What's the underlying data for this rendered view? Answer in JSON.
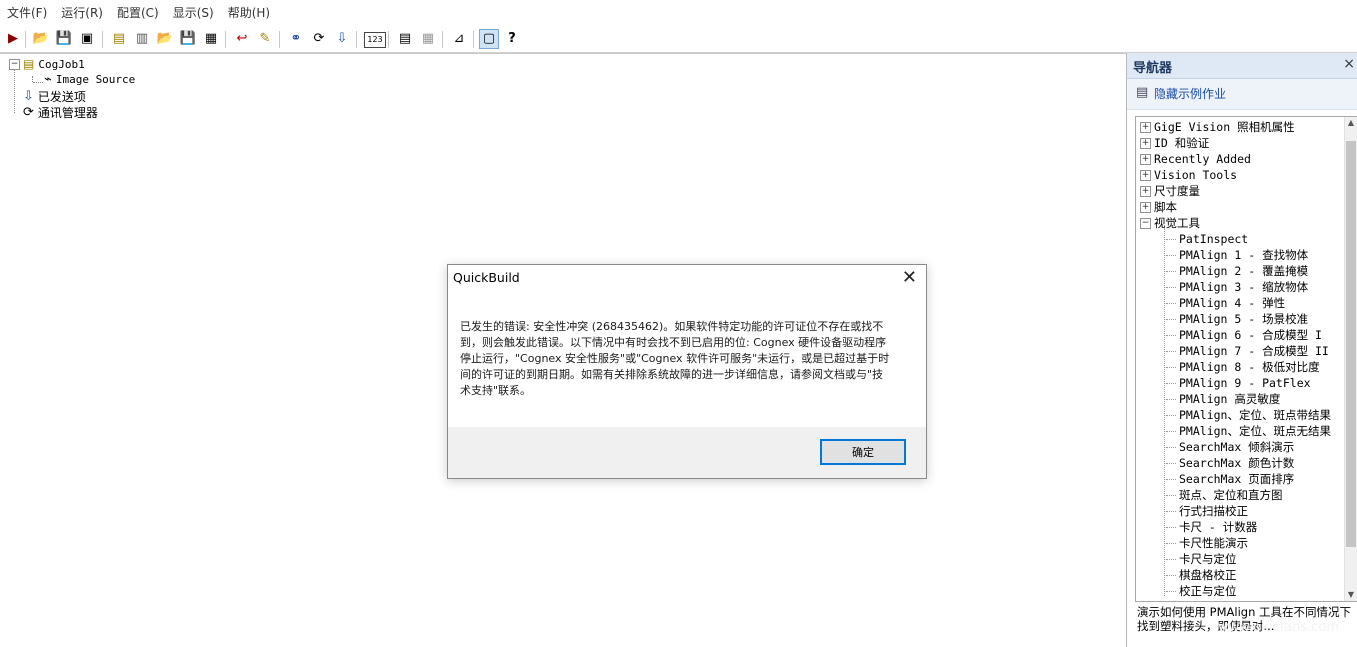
{
  "menubar": {
    "items": [
      "文件(F)",
      "运行(R)",
      "配置(C)",
      "显示(S)",
      "帮助(H)"
    ]
  },
  "toolbar": {
    "buttons": [
      {
        "icon": "run-icon",
        "glyph": "▶",
        "color": "#8b0000"
      },
      {
        "icon": "open-folder-icon",
        "glyph": "📂",
        "color": "#caa300"
      },
      {
        "icon": "save-icon",
        "glyph": "💾",
        "color": "#000"
      },
      {
        "icon": "save-all-icon",
        "glyph": "▣",
        "color": "#000"
      },
      {
        "icon": "job-properties-icon",
        "glyph": "▤",
        "color": "#a08000"
      },
      {
        "icon": "new-job-icon",
        "glyph": "▥",
        "color": "#555"
      },
      {
        "icon": "open-job-icon",
        "glyph": "📂",
        "color": "#caa300"
      },
      {
        "icon": "save-job-icon",
        "glyph": "💾",
        "color": "#000"
      },
      {
        "icon": "save-job-as-icon",
        "glyph": "▦",
        "color": "#000"
      },
      {
        "icon": "reset-icon",
        "glyph": "↩",
        "color": "#c00000"
      },
      {
        "icon": "edit-script-icon",
        "glyph": "✎",
        "color": "#a08000"
      },
      {
        "icon": "link-icon",
        "glyph": "⚭",
        "color": "#1a3fa0"
      },
      {
        "icon": "communication-icon",
        "glyph": "⟳",
        "color": "#000"
      },
      {
        "icon": "posted-items-icon",
        "glyph": "⇩",
        "color": "#2050a0"
      },
      {
        "icon": "numeric-display-icon",
        "glyph": "123",
        "color": "#000"
      },
      {
        "icon": "results-icon",
        "glyph": "▤",
        "color": "#000"
      },
      {
        "icon": "grid-icon",
        "glyph": "▦",
        "color": "#999"
      },
      {
        "icon": "measure-icon",
        "glyph": "⊿",
        "color": "#000"
      },
      {
        "icon": "navigator-icon",
        "glyph": "▢",
        "color": "#000"
      },
      {
        "icon": "help-icon",
        "glyph": "?",
        "color": "#000"
      }
    ]
  },
  "job_tree": {
    "root": "CogJob1",
    "child": "Image Source",
    "posted_items": "已发送项",
    "comm_manager": "通讯管理器"
  },
  "navigator": {
    "title": "导航器",
    "close": "×",
    "hide_samples": "隐藏示例作业",
    "items": [
      "GigE Vision 照相机属性",
      "ID 和验证",
      "Recently Added",
      "Vision Tools",
      "尺寸度量",
      "脚本",
      "视觉工具"
    ],
    "subitems": [
      "PatInspect",
      "PMAlign 1 - 查找物体",
      "PMAlign 2 - 覆盖掩模",
      "PMAlign 3 - 缩放物体",
      "PMAlign 4 - 弹性",
      "PMAlign 5 - 场景校准",
      "PMAlign 6 - 合成模型 I",
      "PMAlign 7 - 合成模型 II",
      "PMAlign 8 - 极低对比度",
      "PMAlign 9 - PatFlex",
      "PMAlign 高灵敏度",
      "PMAlign、定位、斑点带结果",
      "PMAlign、定位、斑点无结果",
      "SearchMax 倾斜演示",
      "SearchMax 颜色计数",
      "SearchMax 页面排序",
      "斑点、定位和直方图",
      "行式扫描校正",
      "卡尺 - 计数器",
      "卡尺性能演示",
      "卡尺与定位",
      "棋盘格校正",
      "校正与定位"
    ],
    "description": "演示如何使用 PMAlign 工具在不同情况下找到塑料接头，即使是对..."
  },
  "dialog": {
    "title": "QuickBuild",
    "close": "✕",
    "message_lines": [
      "已发生的错误: 安全性冲突 (268435462)。如果软件特定功能的许可证位不存在或找不",
      "到，则会触发此错误。以下情况中有时会找不到已启用的位: Cognex 硬件设备驱动程序",
      "停止运行，\"Cognex 安全性服务\"或\"Cognex 软件许可服务\"未运行，或是已超过基于时",
      "间的许可证的到期日期。如需有关排除系统故障的进一步详细信息，请参阅文档或与\"技",
      "术支持\"联系。"
    ],
    "ok_label": "确定"
  },
  "watermark": "www.elecfans.com"
}
